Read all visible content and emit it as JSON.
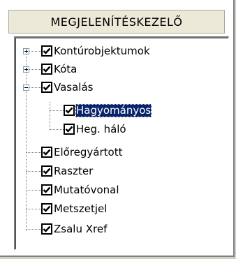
{
  "panel": {
    "title": "MEGJELENÍTÉSKEZELŐ"
  },
  "tree": {
    "items": [
      {
        "label": "Kontúrobjektumok",
        "checked": true,
        "expander": "plus"
      },
      {
        "label": "Kóta",
        "checked": true,
        "expander": "plus"
      },
      {
        "label": "Vasalás",
        "checked": true,
        "expander": "minus"
      },
      {
        "label": "Hagyományos",
        "checked": true,
        "selected": true
      },
      {
        "label": "Heg. háló",
        "checked": true
      },
      {
        "label": "Előregyártott",
        "checked": true
      },
      {
        "label": "Raszter",
        "checked": true
      },
      {
        "label": "Mutatóvonal",
        "checked": true
      },
      {
        "label": "Metszetjel",
        "checked": true
      },
      {
        "label": "Zsalu Xref",
        "checked": true
      }
    ]
  },
  "colors": {
    "selection": "#0a246a",
    "header_bg": "#ece9d8"
  }
}
